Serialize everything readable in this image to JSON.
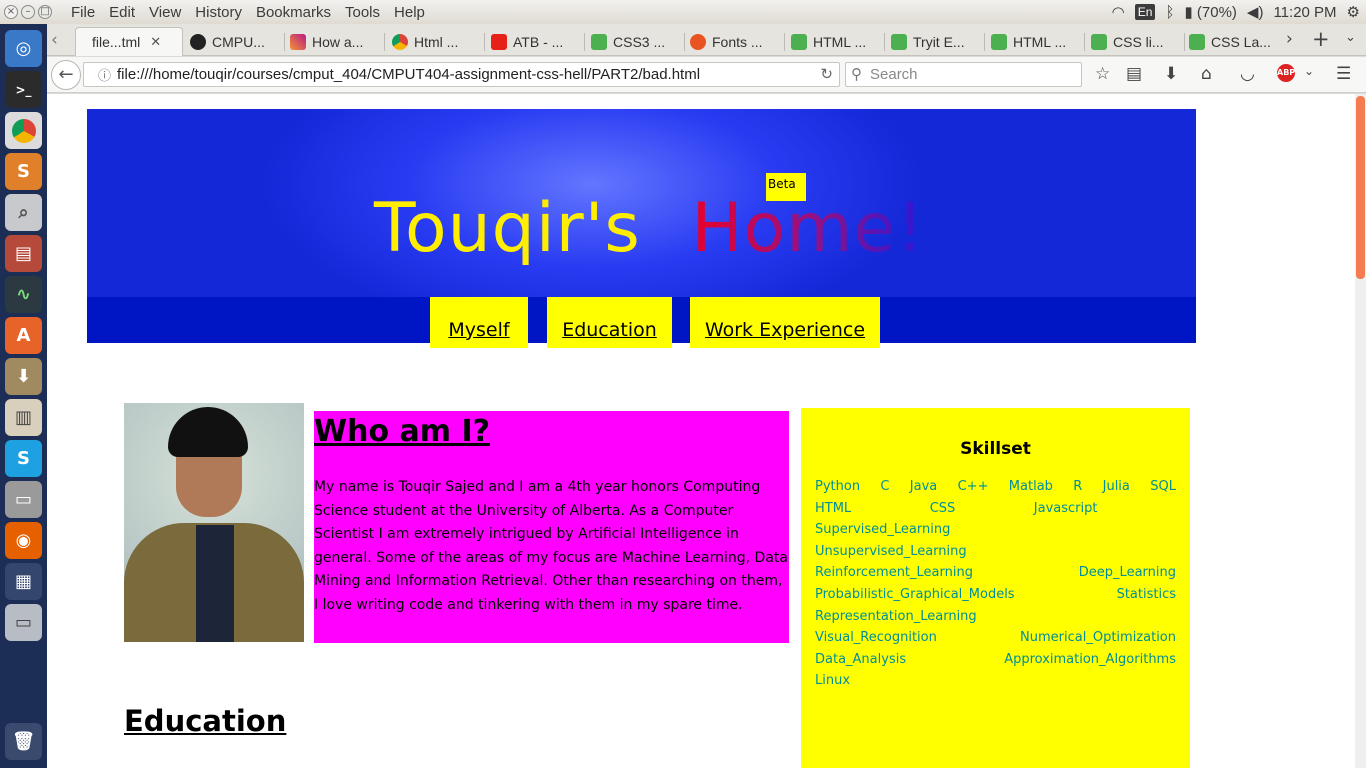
{
  "os": {
    "menus": [
      "File",
      "Edit",
      "View",
      "History",
      "Bookmarks",
      "Tools",
      "Help"
    ],
    "keyboard_layout": "En",
    "battery": "(70%)",
    "clock": "11:20 PM"
  },
  "tabs": [
    {
      "label": "file...tml",
      "icon": "page-icon",
      "active": true
    },
    {
      "label": "CMPU...",
      "icon": "github-icon"
    },
    {
      "label": "How a...",
      "icon": "instagram-icon"
    },
    {
      "label": "Html ...",
      "icon": "chrome-icon"
    },
    {
      "label": "ATB - ...",
      "icon": "youtube-icon"
    },
    {
      "label": "CSS3 ...",
      "icon": "w3-icon"
    },
    {
      "label": "Fonts ...",
      "icon": "ubuntu-icon"
    },
    {
      "label": "HTML ...",
      "icon": "w3-icon"
    },
    {
      "label": "Tryit E...",
      "icon": "w3-icon"
    },
    {
      "label": "HTML ...",
      "icon": "w3-icon"
    },
    {
      "label": "CSS li...",
      "icon": "w3-icon"
    },
    {
      "label": "CSS La...",
      "icon": "w3-icon"
    }
  ],
  "navbar": {
    "url": "file:///home/touqir/courses/cmput_404/CMPUT404-assignment-css-hell/PART2/bad.html",
    "search_placeholder": "Search"
  },
  "page": {
    "title_part1": "Touqir's",
    "title_part2": "Home!",
    "beta": "Beta",
    "nav": [
      "Myself",
      "Education",
      "Work Experience"
    ],
    "about_heading": "Who am I?",
    "about_text": "My name is Touqir Sajed and I am a 4th year honors Computing Science student at the University of Alberta. As a Computer Scientist I am extremely intrigued by Artificial Intelligence in general. Some of the areas of my focus are Machine Learning, Data Mining and Information Retrieval. Other than researching on them, I love writing code and tinkering with them in my spare time.",
    "skills_title": "Skillset",
    "skills": [
      "Python",
      "C",
      "Java",
      "C++",
      "Matlab",
      "R",
      "Julia",
      "SQL",
      "HTML",
      "CSS",
      "Javascript",
      "Supervised_Learning",
      "Unsupervised_Learning",
      "Reinforcement_Learning",
      "Deep_Learning",
      "Probabilistic_Graphical_Models",
      "Statistics",
      "Representation_Learning",
      "Visual_Recognition",
      "Numerical_Optimization",
      "Data_Analysis",
      "Approximation_Algorithms",
      "Linux"
    ],
    "education_heading": "Education"
  },
  "colors": {
    "banner_blue": "#2a3cf2",
    "nav_yellow": "#ffff00",
    "about_magenta": "#ff00ff",
    "skill_teal": "#008f97",
    "title_yellow": "#ffee00",
    "title_red": "#e8002a"
  }
}
